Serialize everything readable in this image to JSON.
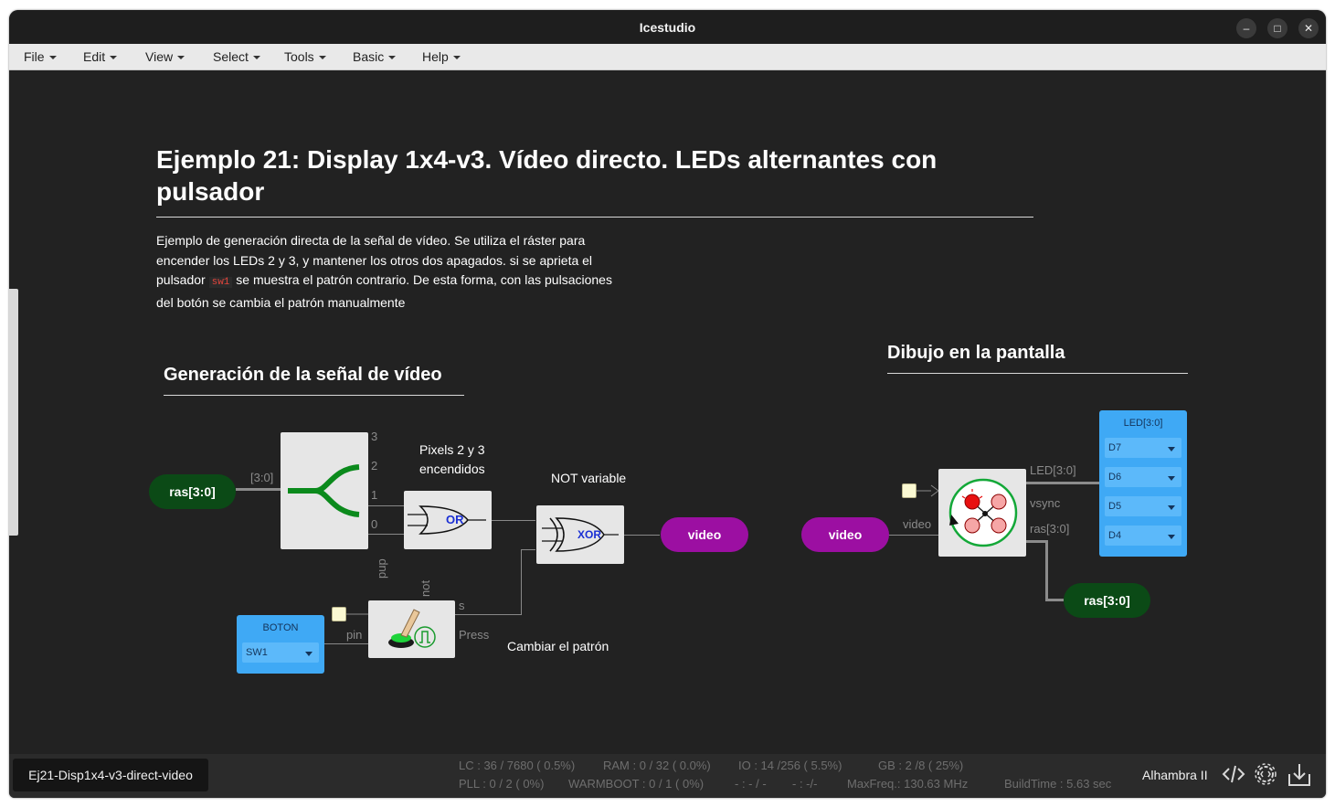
{
  "window": {
    "title": "Icestudio"
  },
  "menu": [
    {
      "label": "File"
    },
    {
      "label": "Edit"
    },
    {
      "label": "View"
    },
    {
      "label": "Select"
    },
    {
      "label": "Tools"
    },
    {
      "label": "Basic"
    },
    {
      "label": "Help"
    }
  ],
  "doc": {
    "title": "Ejemplo 21: Display 1x4-v3. Vídeo directo. LEDs alternantes con pulsador",
    "para_1": "Ejemplo de generación directa de la señal de vídeo. Se utiliza el ráster para encender los LEDs 2 y 3, y mantener los otros dos apagados. si se aprieta el pulsador",
    "para_code": "sw1",
    "para_2": "se muestra el patrón contrario. De esta forma, con las pulsaciones del botón se cambia el patrón manualmente"
  },
  "section_left": {
    "title": "Generación de la señal de vídeo"
  },
  "section_right": {
    "title": "Dibujo en la pantalla"
  },
  "circuit": {
    "ras_in": "ras[3:0]",
    "ras_bus_label": "[3:0]",
    "split_ports": [
      "3",
      "2",
      "1",
      "0"
    ],
    "pixels_label": "Pixels 2 y 3 encendidos",
    "or_label": "OR",
    "not_variable_label": "NOT variable",
    "xor_label": "XOR",
    "video_out": "video",
    "boton_title": "BOTON",
    "boton_pin": "SW1",
    "pin_label": "pin",
    "pup_label": "pup",
    "not_label": "not",
    "s_label": "s",
    "press_label": "Press",
    "cambiar_label": "Cambiar el patrón",
    "video_in": "video",
    "video_port": "video",
    "led_port": "LED[3:0]",
    "vsync_port": "vsync",
    "ras_port": "ras[3:0]",
    "ras_out": "ras[3:0]",
    "led_title": "LED[3:0]",
    "led_pins": [
      "D7",
      "D6",
      "D5",
      "D4"
    ]
  },
  "status": {
    "file": "Ej21-Disp1x4-v3-direct-video",
    "lc": "LC : 36 / 7680 ( 0.5%)",
    "ram": "RAM : 0 / 32 ( 0.0%)",
    "io": "IO :  14 /256  ( 5.5%)",
    "gb": "GB :  2 /8  ( 25%)",
    "pll": "PLL : 0 / 2 ( 0%)",
    "warmboot": "WARMBOOT : 0 / 1 ( 0%)",
    "blank1": "- : - / -",
    "blank2": "- :  -/-",
    "maxfreq": "MaxFreq.:  130.63 MHz",
    "buildtime": "BuildTime :  5.63 sec",
    "board": "Alhambra II"
  },
  "colors": {
    "green_port": "#0b4a16",
    "purple_port": "#9c0fa2",
    "input_block": "#3fa9f5",
    "canvas": "#222222"
  }
}
